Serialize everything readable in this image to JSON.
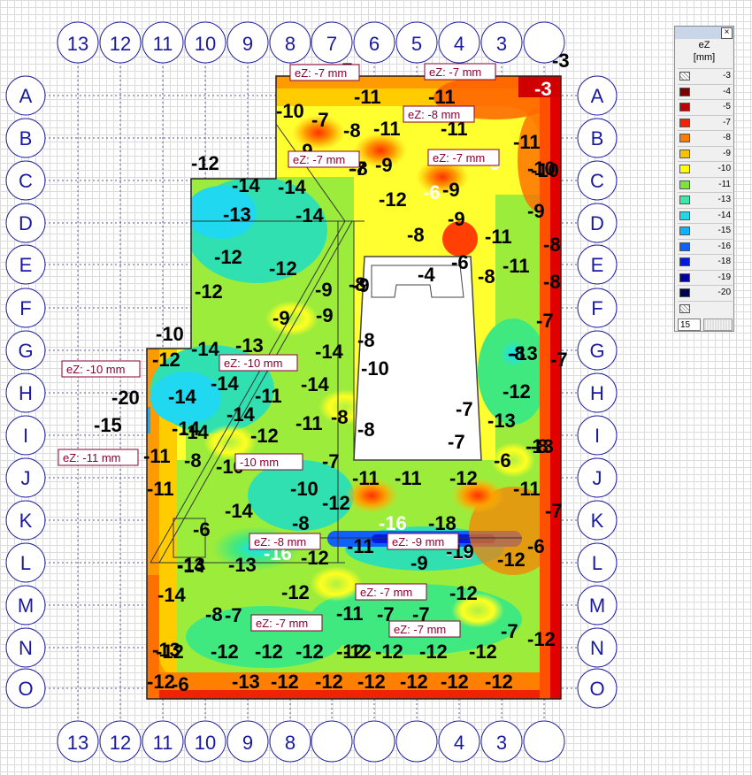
{
  "legend": {
    "close_label": "×",
    "title": "eZ",
    "unit": "[mm]",
    "input_value": "15",
    "rows": [
      {
        "value": "-3",
        "color": "hatch"
      },
      {
        "value": "-4",
        "color": "#7a0000"
      },
      {
        "value": "-5",
        "color": "#c00000"
      },
      {
        "value": "-7",
        "color": "#ee2400"
      },
      {
        "value": "-8",
        "color": "#ff7b00"
      },
      {
        "value": "-9",
        "color": "#ffc000"
      },
      {
        "value": "-10",
        "color": "#ffff00"
      },
      {
        "value": "-11",
        "color": "#7fe23a"
      },
      {
        "value": "-13",
        "color": "#3ae8a8"
      },
      {
        "value": "-14",
        "color": "#20d8e8"
      },
      {
        "value": "-15",
        "color": "#10b0ff"
      },
      {
        "value": "-16",
        "color": "#1060ff"
      },
      {
        "value": "-18",
        "color": "#0018e0"
      },
      {
        "value": "-19",
        "color": "#0000a0"
      },
      {
        "value": "-20",
        "color": "#000050"
      },
      {
        "value": "",
        "color": "hatch"
      }
    ]
  },
  "axes": {
    "columns_top": [
      "13",
      "12",
      "11",
      "10",
      "9",
      "8",
      "7",
      "6",
      "5",
      "4",
      "3",
      ""
    ],
    "columns_bottom": [
      "13",
      "12",
      "11",
      "10",
      "9",
      "8",
      "",
      "",
      "",
      "4",
      "3",
      ""
    ],
    "rows": [
      "A",
      "B",
      "C",
      "D",
      "E",
      "F",
      "G",
      "H",
      "I",
      "J",
      "K",
      "L",
      "M",
      "N",
      "O"
    ]
  },
  "tags": [
    "eZ: -7 mm",
    "eZ: -7 mm",
    "eZ: -8 mm",
    "eZ: -7 mm",
    "eZ: -7 mm",
    "eZ: -10 mm",
    "eZ: -10 mm",
    "eZ: -11 mm",
    "-10 mm",
    "eZ: -8 mm",
    "eZ: -9 mm",
    "eZ: -7 mm",
    "eZ: -7 mm",
    "eZ: -7 mm"
  ],
  "values": [
    "-3",
    "-7",
    "-3",
    "-11",
    "-11",
    "-10",
    "-7",
    "-8",
    "-11",
    "-11",
    "-11",
    "-9",
    "-7",
    "-9",
    "-9",
    "-10",
    "-8",
    "-10",
    "-12",
    "-14",
    "-14",
    "-12",
    "-6",
    "-9",
    "-9",
    "-13",
    "-14",
    "-8",
    "-9",
    "-11",
    "-8",
    "-12",
    "-12",
    "-4",
    "-6",
    "-11",
    "-8",
    "-12",
    "-9",
    "-8",
    "-8",
    "-9",
    "-9",
    "-9",
    "-7",
    "-10",
    "-14",
    "-13",
    "-8",
    "-7",
    "-12",
    "-14",
    "-10",
    "-14",
    "-8",
    "-13",
    "-14",
    "-14",
    "-11",
    "-14",
    "-12",
    "-20",
    "-14",
    "-8",
    "-11",
    "-7",
    "-7",
    "-13",
    "-15",
    "-14",
    "-12",
    "-8",
    "-13",
    "-11",
    "-8",
    "-11",
    "-10",
    "-7",
    "-6",
    "-8",
    "-11",
    "-12",
    "-11",
    "-11",
    "-10",
    "-14",
    "-12",
    "-7",
    "-6",
    "-8",
    "-16",
    "-18",
    "-19",
    "-14",
    "-13",
    "-16",
    "-12",
    "-11",
    "-9",
    "-19",
    "-12",
    "-6",
    "-14",
    "-12",
    "-12",
    "-8",
    "-7",
    "-11",
    "-7",
    "-7",
    "-7",
    "-12",
    "-13",
    "-12",
    "-12",
    "-12",
    "-12",
    "-12",
    "-12",
    "-12",
    "-6",
    "-13",
    "-12",
    "-12",
    "-12",
    "-12",
    "-12",
    "-12",
    "-12",
    "-12",
    "-12",
    "-13",
    "-14"
  ]
}
